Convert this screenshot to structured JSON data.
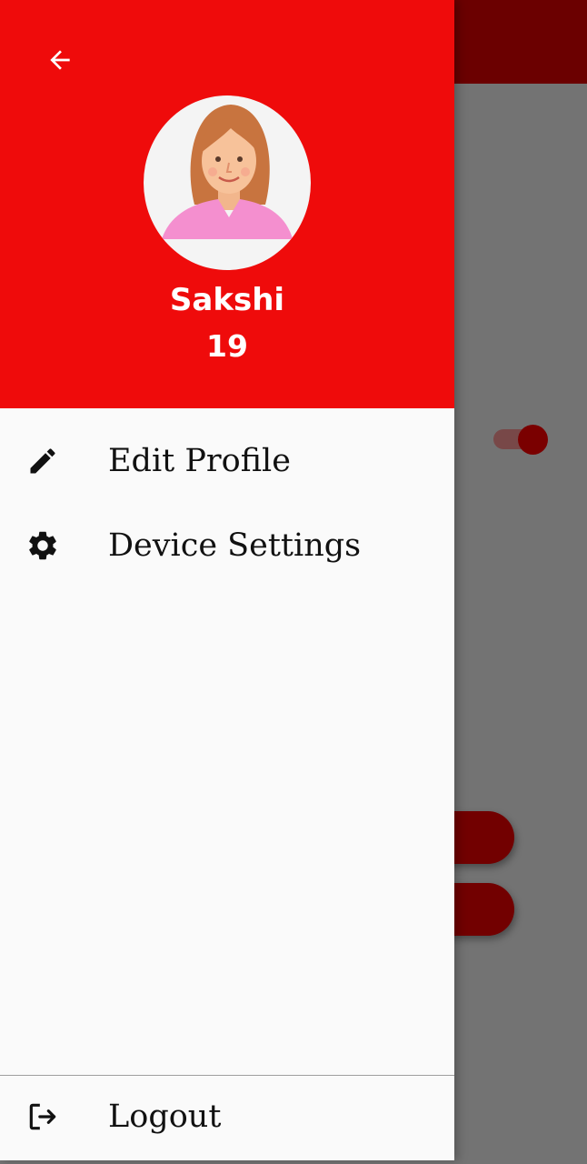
{
  "drawer": {
    "header": {
      "back_icon": "arrow-back-icon",
      "avatar_icon": "female-user-avatar",
      "name": "Sakshi",
      "age": "19",
      "background_color": "#ef0b0b"
    },
    "menu": [
      {
        "label": "Edit Profile",
        "icon": "pencil-icon"
      },
      {
        "label": "Device Settings",
        "icon": "gear-icon"
      }
    ],
    "logout": {
      "label": "Logout",
      "icon": "logout-icon"
    }
  },
  "background_app": {
    "appbar_color": "#6b0000",
    "scrim_color": "#737373",
    "toggle_on": true
  }
}
